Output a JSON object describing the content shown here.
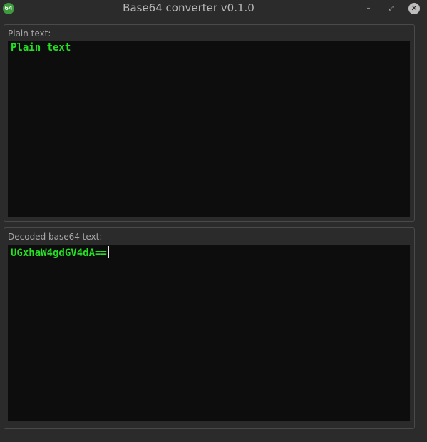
{
  "window": {
    "title": "Base64 converter v0.1.0",
    "app_icon_text": "64",
    "controls": {
      "minimize": "–",
      "maximize": "⤢",
      "close": "✕"
    }
  },
  "plain_section": {
    "label": "Plain text:",
    "value": "Plain text"
  },
  "decoded_section": {
    "label": "Decoded base64 text:",
    "value": "UGxhaW4gdGV4dA=="
  },
  "colors": {
    "background": "#2b2b2b",
    "editor_background": "#0d0d0d",
    "text_accent": "#23e023"
  }
}
